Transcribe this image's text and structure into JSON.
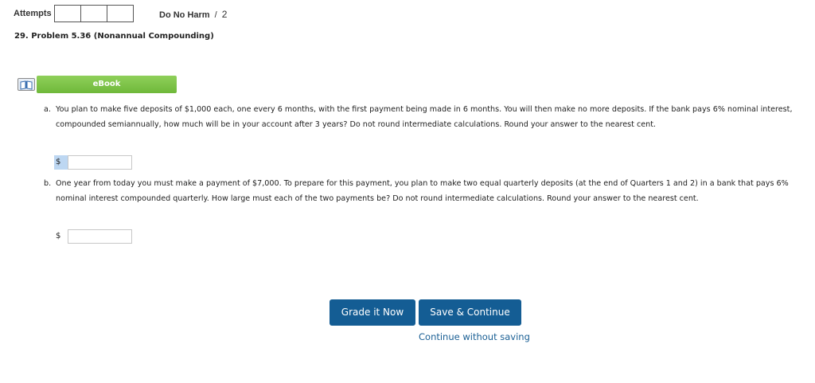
{
  "header": {
    "attempts_label": "Attempts",
    "attempt_boxes": 3,
    "policy_name": "Do No Harm",
    "policy_sep": "/",
    "policy_count": "2"
  },
  "problem": {
    "title": "29.  Problem 5.36 (Nonannual Compounding)"
  },
  "ebook": {
    "label": "eBook",
    "icon": "book-icon"
  },
  "questions": {
    "a": {
      "letter": "a.",
      "text": "You plan to make five deposits of $1,000 each, one every 6 months, with the first payment being made in 6 months. You will then make no more deposits. If the bank pays 6% nominal interest, compounded semiannually, how much will be in your account after 3 years? Do not round intermediate calculations. Round your answer to the nearest cent.",
      "currency": "$",
      "value": ""
    },
    "b": {
      "letter": "b.",
      "text": "One year from today you must make a payment of $7,000. To prepare for this payment, you plan to make two equal quarterly deposits (at the end of Quarters 1 and 2) in a bank that pays 6% nominal interest compounded quarterly. How large must each of the two payments be? Do not round intermediate calculations. Round your answer to the nearest cent.",
      "currency": "$",
      "value": ""
    }
  },
  "actions": {
    "grade_label": "Grade it Now",
    "save_label": "Save & Continue",
    "continue_label": "Continue without saving"
  },
  "colors": {
    "primary_button": "#145d94",
    "ebook_green": "#7cc244",
    "link": "#1a5f94",
    "highlight": "#bdd7f2"
  }
}
